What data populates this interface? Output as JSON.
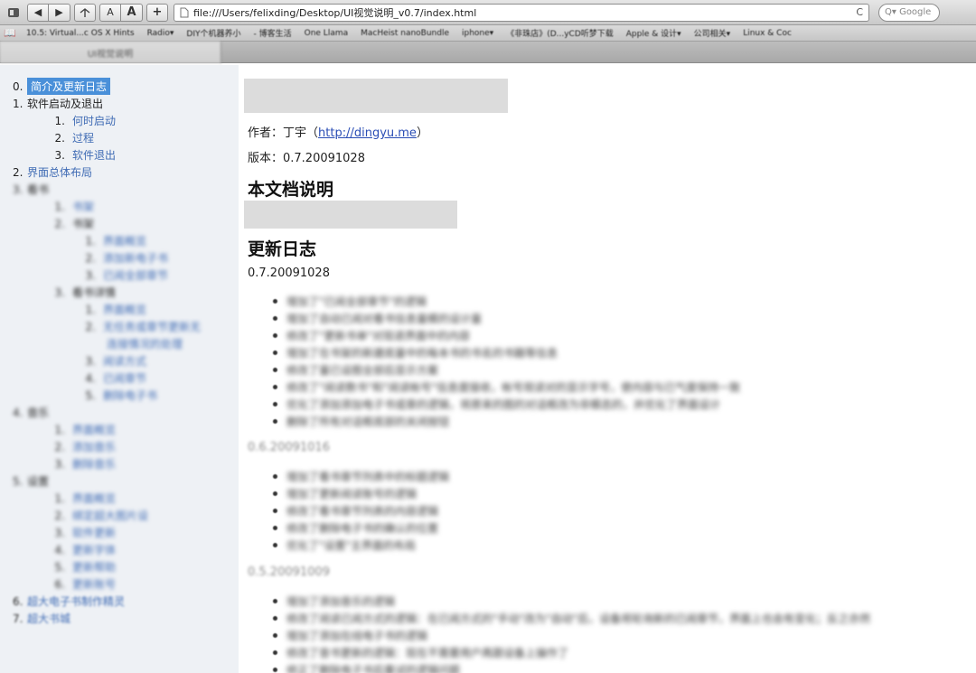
{
  "toolbar": {
    "back_label": "◀",
    "forward_label": "▶",
    "smaller_text_label": "A",
    "larger_text_label": "A",
    "add_bookmark_label": "+",
    "url": "file:///Users/felixding/Desktop/UI视觉说明_v0.7/index.html",
    "reload_label": "C",
    "search_placeholder": "Q▾ Google"
  },
  "bookmarks": [
    "10.5: Virtual...c OS X Hints",
    "Radio▾",
    "DIY个机器养小",
    "- 博客生活",
    "One Llama",
    "MacHeist nanoBundle",
    "iphone▾",
    "《非珠店》(D...yCD听梦下载",
    "Apple & 设计▾",
    "公司相关▾",
    "Linux & Coc"
  ],
  "tab": {
    "title": "UI视觉说明"
  },
  "toc": [
    {
      "num": "0.",
      "label": "简介及更新日志",
      "level": 1,
      "selected": true
    },
    {
      "num": "1.",
      "label": "软件启动及退出",
      "level": 1,
      "dark": true
    },
    {
      "num": "1.",
      "label": "何时启动",
      "level": 2
    },
    {
      "num": "2.",
      "label": "过程",
      "level": 2
    },
    {
      "num": "3.",
      "label": "软件退出",
      "level": 2
    },
    {
      "num": "2.",
      "label": "界面总体布局",
      "level": 1
    },
    {
      "num": "3.",
      "label": "看书",
      "level": 1,
      "dark": true,
      "blurred": true
    },
    {
      "num": "1.",
      "label": "书架",
      "level": 2,
      "blurred": true
    },
    {
      "num": "2.",
      "label": "书架",
      "level": 2,
      "dark": true,
      "blurred": true
    },
    {
      "num": "1.",
      "label": "界面概览",
      "level": 3,
      "blurred": true
    },
    {
      "num": "2.",
      "label": "添加新电子书",
      "level": 3,
      "blurred": true
    },
    {
      "num": "3.",
      "label": "已阅全部章节",
      "level": 3,
      "blurred": true
    },
    {
      "num": "3.",
      "label": "看书详情",
      "level": 2,
      "dark": true,
      "blurred": true
    },
    {
      "num": "1.",
      "label": "界面概览",
      "level": 3,
      "blurred": true
    },
    {
      "num": "2.",
      "label": "无任务或章节更新无",
      "level": 3,
      "blurred": true,
      "cont": "连接情况的处理"
    },
    {
      "num": "3.",
      "label": "阅读方式",
      "level": 3,
      "blurred": true
    },
    {
      "num": "4.",
      "label": "已阅章节",
      "level": 3,
      "blurred": true
    },
    {
      "num": "5.",
      "label": "删除电子书",
      "level": 3,
      "blurred": true
    },
    {
      "num": "4.",
      "label": "音乐",
      "level": 1,
      "dark": true,
      "blurred": true
    },
    {
      "num": "1.",
      "label": "界面概览",
      "level": 2,
      "blurred": true
    },
    {
      "num": "2.",
      "label": "添加音乐",
      "level": 2,
      "blurred": true
    },
    {
      "num": "3.",
      "label": "删除音乐",
      "level": 2,
      "blurred": true
    },
    {
      "num": "5.",
      "label": "设置",
      "level": 1,
      "dark": true,
      "blurred": true
    },
    {
      "num": "1.",
      "label": "界面概览",
      "level": 2,
      "blurred": true
    },
    {
      "num": "2.",
      "label": "绑定超大图片设",
      "level": 2,
      "blurred": true
    },
    {
      "num": "3.",
      "label": "软件更新",
      "level": 2,
      "blurred": true
    },
    {
      "num": "4.",
      "label": "更新字体",
      "level": 2,
      "blurred": true
    },
    {
      "num": "5.",
      "label": "更新帮助",
      "level": 2,
      "blurred": true
    },
    {
      "num": "6.",
      "label": "更新账号",
      "level": 2,
      "blurred": true
    },
    {
      "num": "6.",
      "label": "超大电子书制作精灵",
      "level": 1,
      "blurred_light": true
    },
    {
      "num": "7.",
      "label": "超大书城",
      "level": 1,
      "blurred_light": true
    }
  ],
  "content": {
    "author_label": "作者：丁宇（",
    "author_link": "http://dingyu.me",
    "author_suffix": "）",
    "version_line": "版本：0.7.20091028",
    "section_doc": "本文档说明",
    "section_changelog": "更新日志",
    "versions": [
      {
        "version": "0.7.20091028",
        "items": [
          "增加了\"已阅全部章节\"的逻辑",
          "增加了自动已阅对看书信息量模的设计量",
          "修改了\"更新书单\"对现退界面中的内容",
          "增加了在书架的新建底量中的每本书的书名的书籍等信息",
          "修改了量已设图全部后显示方案",
          "修改了\"阅读数书\"和\"阅读帐号\"信息度接收，帐号观读对的显示字号，使内容与已气度保持一致",
          "优化了添加添加电子书或章的逻辑，将原来的图的对话框改为非模态的，并优化了界面设计",
          "删除了所有对话框底部的关闭按钮"
        ]
      },
      {
        "version": "0.6.20091016",
        "items": [
          "增加了看书章节列表中的标题逻辑",
          "增加了更新阅读账号的逻辑",
          "修改了看书章节列表的内容逻辑",
          "修改了删除电子书的确认的位置",
          "优化了\"设置\"主界面的布局"
        ]
      },
      {
        "version": "0.5.20091009",
        "items": [
          "增加了添加音乐的逻辑",
          "修改了阅读已阅方式的逻辑：在已阅方式的\"手动\"改为\"自动\"后，设备将轮询新的已阅章节，界面上也会有变化；反之亦然",
          "增加了添加在线电子书的逻辑",
          "修改了音书更新的逻辑：现在不需要用户再跟设备上操作了",
          "修正了删除电子书后重试的逻辑问题"
        ]
      }
    ]
  }
}
